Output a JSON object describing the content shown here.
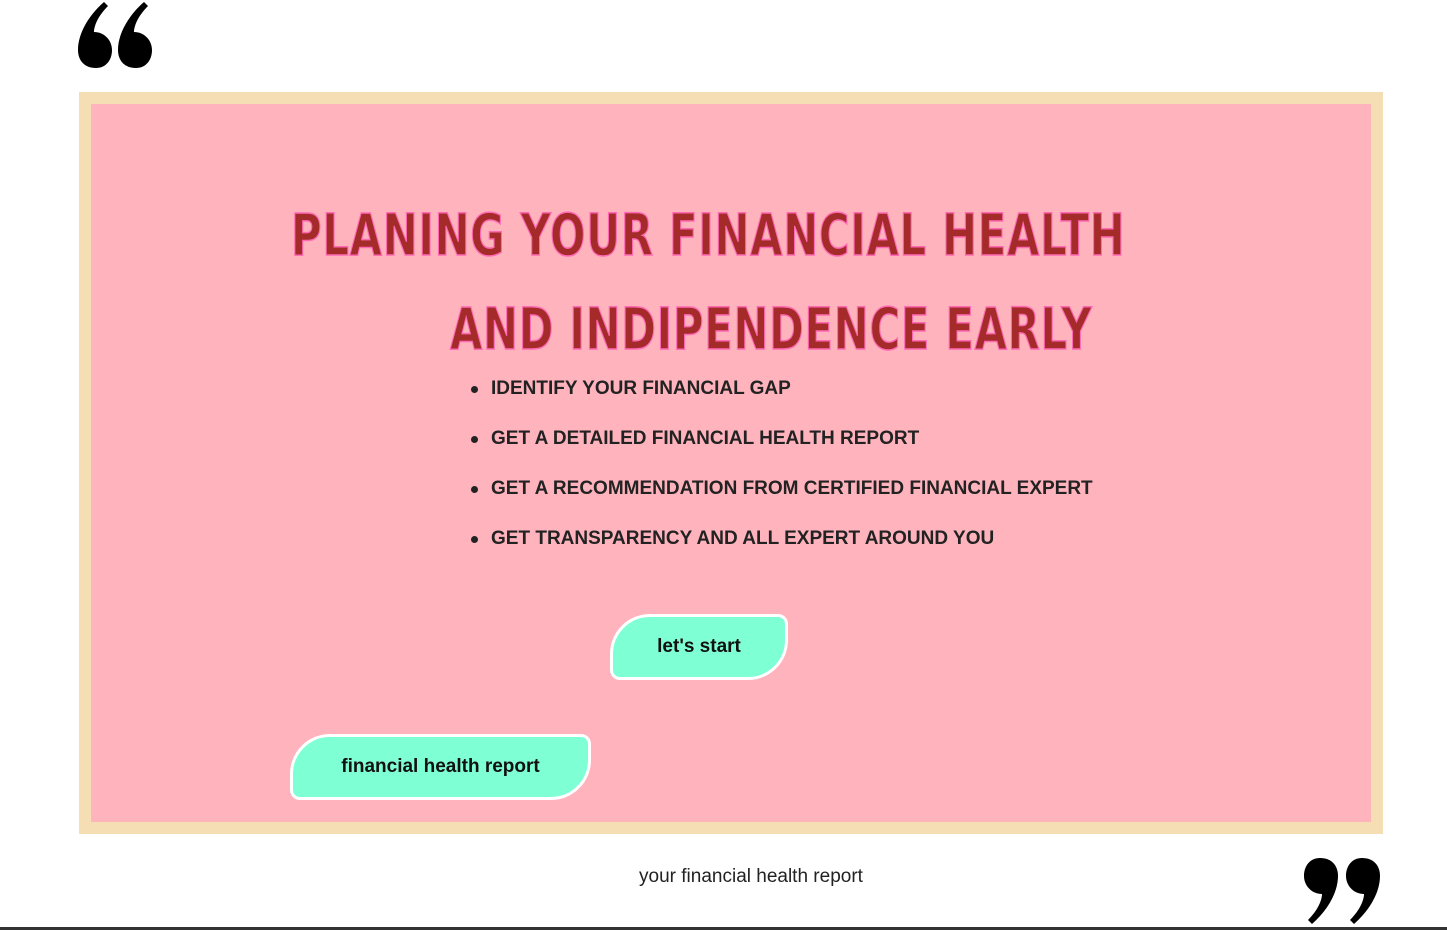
{
  "quotes": {
    "open_icon": "quote-open-icon",
    "close_icon": "quote-close-icon"
  },
  "hero": {
    "headline_line1": "PLANING YOUR FINANCIAL HEALTH",
    "headline_line2": "AND INDIPENDENCE EARLY",
    "features": [
      "IDENTIFY YOUR FINANCIAL GAP",
      "GET A DETAILED FINANCIAL HEALTH REPORT",
      "GET A RECOMMENDATION FROM CERTIFIED FINANCIAL EXPERT",
      "GET TRANSPARENCY AND ALL EXPERT AROUND YOU"
    ],
    "start_button_label": "let's start",
    "report_button_label": "financial health report"
  },
  "footer": {
    "caption": "your financial health report"
  },
  "colors": {
    "frame": "#f5deb3",
    "card": "#ffb3bd",
    "headline": "#a52a2a",
    "headline_stroke": "#ff69b4",
    "button": "#7fffd4"
  }
}
